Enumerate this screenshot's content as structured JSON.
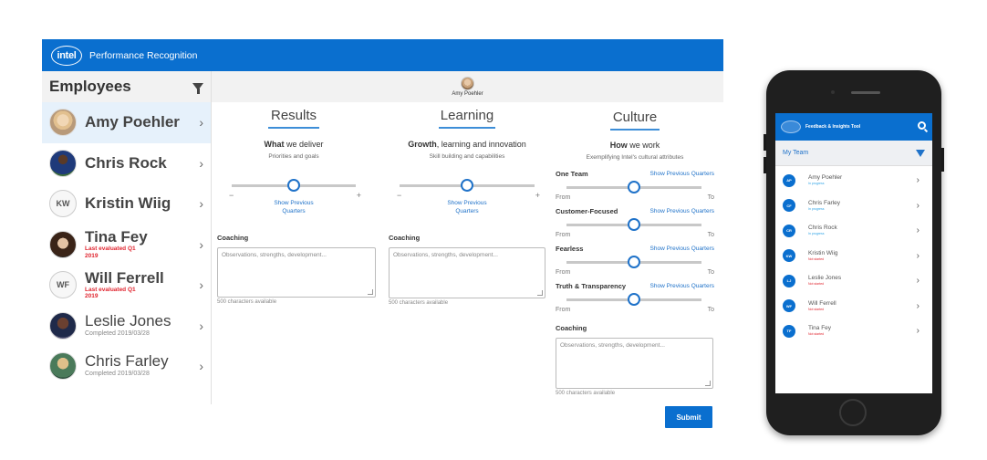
{
  "app": {
    "logo_text": "intel",
    "title": "Performance Recognition"
  },
  "sidebar": {
    "title": "Employees",
    "employees": [
      {
        "name": "Amy Poehler",
        "initials": "",
        "status": "",
        "status_type": "",
        "active": true
      },
      {
        "name": "Chris Rock",
        "initials": "",
        "status": "",
        "status_type": ""
      },
      {
        "name": "Kristin Wiig",
        "initials": "KW",
        "status": "",
        "status_type": ""
      },
      {
        "name": "Tina Fey",
        "initials": "",
        "status": "Last evaluated Q1 2019",
        "status_type": "overdue"
      },
      {
        "name": "Will Ferrell",
        "initials": "WF",
        "status": "Last evaluated Q1 2019",
        "status_type": "overdue"
      },
      {
        "name": "Leslie Jones",
        "initials": "",
        "status": "Completed 2019/03/28",
        "status_type": "completed"
      },
      {
        "name": "Chris Farley",
        "initials": "",
        "status": "Completed 2019/03/28",
        "status_type": "completed"
      }
    ]
  },
  "main": {
    "selected_person": "Amy Poehler",
    "results": {
      "tab": "Results",
      "heading_bold": "What",
      "heading_rest": " we deliver",
      "description": "Priorities and goals",
      "slider_value": 0.5,
      "min_label": "−",
      "max_label": "+",
      "link": "Show Previous Quarters",
      "coaching_label": "Coaching",
      "coaching_placeholder": "Observations, strengths, development...",
      "chars_available": "500 characters available"
    },
    "learning": {
      "tab": "Learning",
      "heading_bold": "Growth",
      "heading_rest": ", learning and innovation",
      "description": "Skill building and capabilities",
      "slider_value": 0.5,
      "min_label": "−",
      "max_label": "+",
      "link": "Show Previous Quarters",
      "coaching_label": "Coaching",
      "coaching_placeholder": "Observations, strengths, development...",
      "chars_available": "500 characters available"
    },
    "culture": {
      "tab": "Culture",
      "heading_bold": "How",
      "heading_rest": " we work",
      "description": "Exemplifying Intel's cultural attributes",
      "from_label": "From",
      "to_label": "To",
      "link": "Show Previous Quarters",
      "attributes": [
        {
          "label": "One Team",
          "value": 0.5
        },
        {
          "label": "Customer-Focused",
          "value": 0.5
        },
        {
          "label": "Fearless",
          "value": 0.5
        },
        {
          "label": "Truth & Transparency",
          "value": 0.5
        }
      ],
      "coaching_label": "Coaching",
      "coaching_placeholder": "Observations, strengths, development...",
      "chars_available": "500 characters available"
    },
    "submit_label": "Submit"
  },
  "phone": {
    "title": "Feedback & Insights Tool",
    "team_label": "My Team",
    "members": [
      {
        "name": "Amy Poehler",
        "initials": "AP",
        "status": "In progress",
        "status_type": "ok"
      },
      {
        "name": "Chris Farley",
        "initials": "CF",
        "status": "In progress",
        "status_type": "ok"
      },
      {
        "name": "Chris Rock",
        "initials": "CR",
        "status": "In progress",
        "status_type": "ok"
      },
      {
        "name": "Kristin Wiig",
        "initials": "KW",
        "status": "Not started",
        "status_type": "bad"
      },
      {
        "name": "Leslie Jones",
        "initials": "LJ",
        "status": "Not started",
        "status_type": "bad"
      },
      {
        "name": "Will Ferrell",
        "initials": "WF",
        "status": "Not started",
        "status_type": "bad"
      },
      {
        "name": "Tina Fey",
        "initials": "TF",
        "status": "Not started",
        "status_type": "bad"
      }
    ]
  },
  "colors": {
    "brand_blue": "#0a6fcf",
    "link_blue": "#1f72c9",
    "overdue_red": "#e0252f",
    "active_row": "#e6f1fb"
  }
}
